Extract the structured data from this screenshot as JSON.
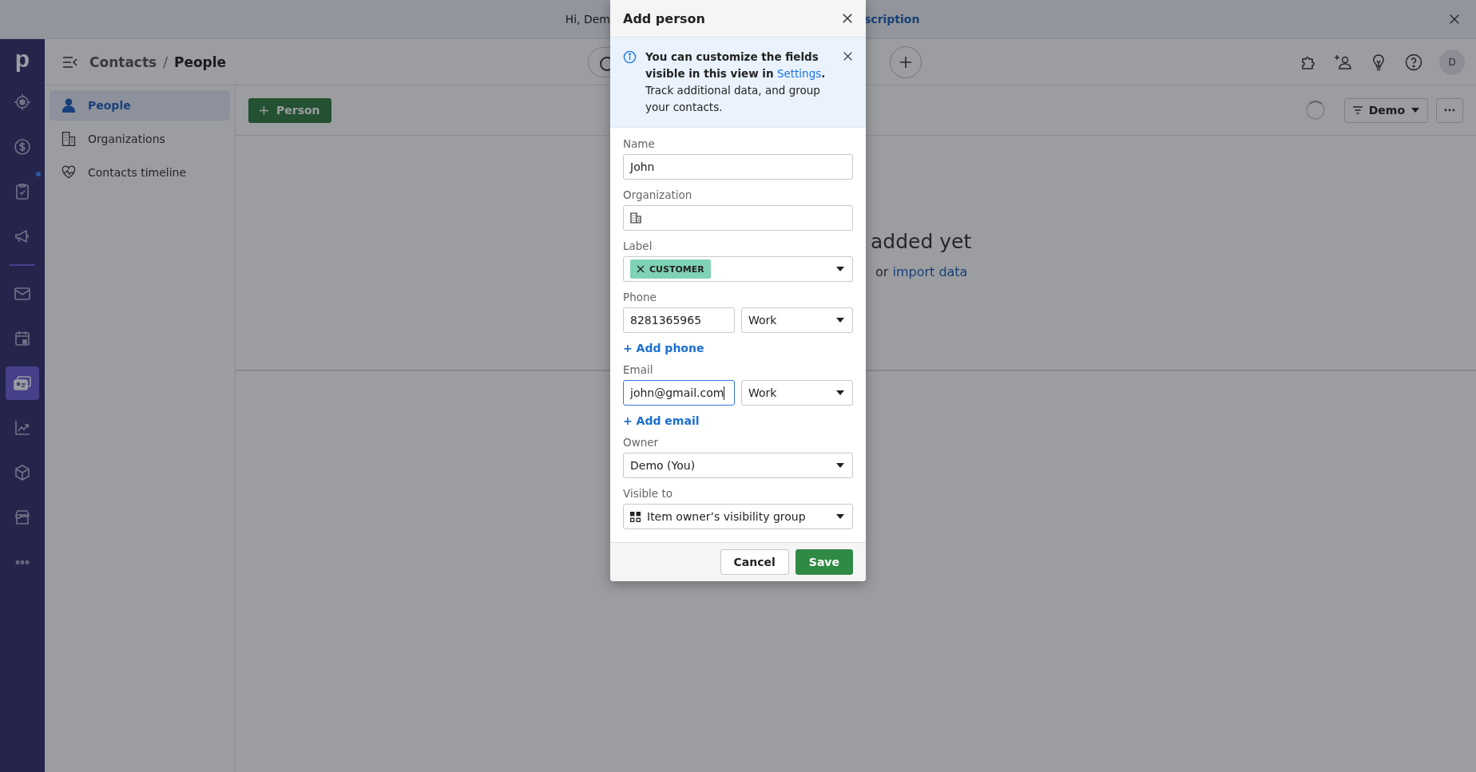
{
  "banner": {
    "greeting": "Hi, Dem",
    "link": "scription"
  },
  "nav_rail": {
    "logo": "p",
    "items": [
      {
        "selected": false,
        "dot": false
      },
      {
        "selected": false,
        "dot": false
      },
      {
        "selected": false,
        "dot": true
      },
      {
        "selected": false,
        "dot": false
      },
      {
        "selected": false,
        "dot": false
      },
      {
        "selected": false,
        "dot": false
      },
      {
        "selected": true,
        "dot": false
      },
      {
        "selected": false,
        "dot": false
      },
      {
        "selected": false,
        "dot": false
      },
      {
        "selected": false,
        "dot": false
      },
      {
        "selected": false,
        "dot": false
      }
    ]
  },
  "header": {
    "breadcrumb": [
      "Contacts",
      "People"
    ],
    "separator": "/",
    "avatar": "D"
  },
  "subnav": {
    "items": [
      {
        "label": "People",
        "selected": true
      },
      {
        "label": "Organizations",
        "selected": false
      },
      {
        "label": "Contacts timeline",
        "selected": false
      }
    ]
  },
  "toolbar": {
    "add_button": "Person",
    "filter": "Demo"
  },
  "empty_state": {
    "title": "added yet",
    "text": "or",
    "link": "import data"
  },
  "modal": {
    "title": "Add person",
    "info": {
      "before": "**You can customize the fields visible in this view in**",
      "link": "Settings",
      "after": "**.** Track additional data, and group your contacts."
    },
    "fields": [
      {
        "label": "Name",
        "kind": "text",
        "value": "John"
      },
      {
        "label": "Organization",
        "kind": "organization"
      },
      {
        "label": "Label",
        "kind": "tags",
        "tags": [
          {
            "text": "CUSTOMER",
            "color": "#7fd3b4"
          }
        ]
      },
      {
        "label": "Phone",
        "kind": "contact",
        "value": "8281365965",
        "type": "Work",
        "focused": false,
        "add_link": "+ Add phone"
      },
      {
        "label": "Email",
        "kind": "contact",
        "value": "john@gmail.com",
        "type": "Work",
        "focused": true,
        "add_link": "+ Add email"
      },
      {
        "label": "Owner",
        "kind": "select",
        "value": "Demo (You)"
      },
      {
        "label": "Visible to",
        "kind": "visibility",
        "value": "Item owner’s visibility group"
      }
    ],
    "buttons": [
      {
        "label": "Cancel",
        "kind": "secondary"
      },
      {
        "label": "Save",
        "kind": "primary"
      }
    ]
  }
}
